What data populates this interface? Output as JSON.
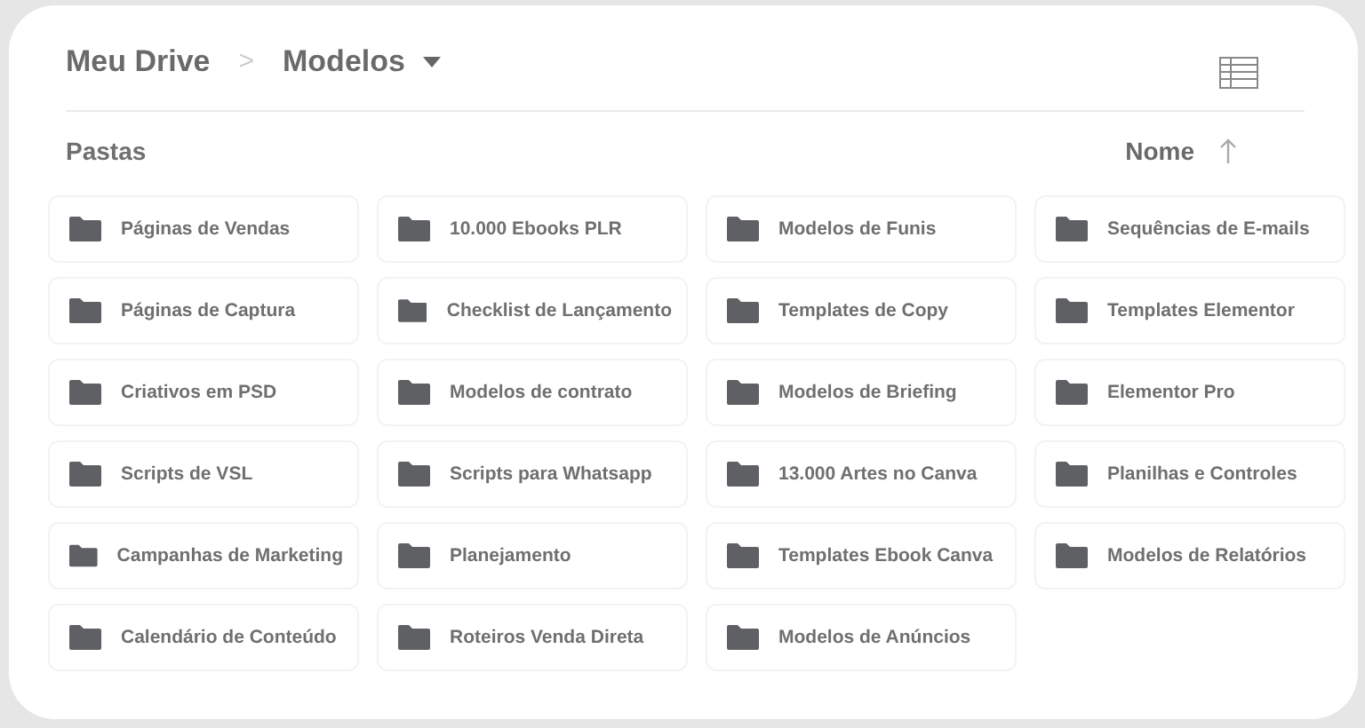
{
  "breadcrumb": {
    "root": "Meu Drive",
    "separator": ">",
    "current": "Modelos"
  },
  "section_title": "Pastas",
  "sort": {
    "label": "Nome"
  },
  "folders": [
    {
      "name": "Páginas de Vendas"
    },
    {
      "name": "10.000 Ebooks PLR"
    },
    {
      "name": "Modelos de Funis"
    },
    {
      "name": "Sequências de E-mails"
    },
    {
      "name": "Páginas de Captura"
    },
    {
      "name": "Checklist de Lançamento"
    },
    {
      "name": "Templates de Copy"
    },
    {
      "name": "Templates Elementor"
    },
    {
      "name": "Criativos em PSD"
    },
    {
      "name": "Modelos de contrato"
    },
    {
      "name": "Modelos de Briefing"
    },
    {
      "name": "Elementor Pro"
    },
    {
      "name": "Scripts de VSL"
    },
    {
      "name": "Scripts para Whatsapp"
    },
    {
      "name": "13.000 Artes no Canva"
    },
    {
      "name": "Planilhas e Controles"
    },
    {
      "name": "Campanhas de Marketing"
    },
    {
      "name": "Planejamento"
    },
    {
      "name": "Templates Ebook Canva"
    },
    {
      "name": "Modelos de Relatórios"
    },
    {
      "name": "Calendário de Conteúdo"
    },
    {
      "name": "Roteiros Venda Direta"
    },
    {
      "name": "Modelos de Anúncios"
    }
  ]
}
